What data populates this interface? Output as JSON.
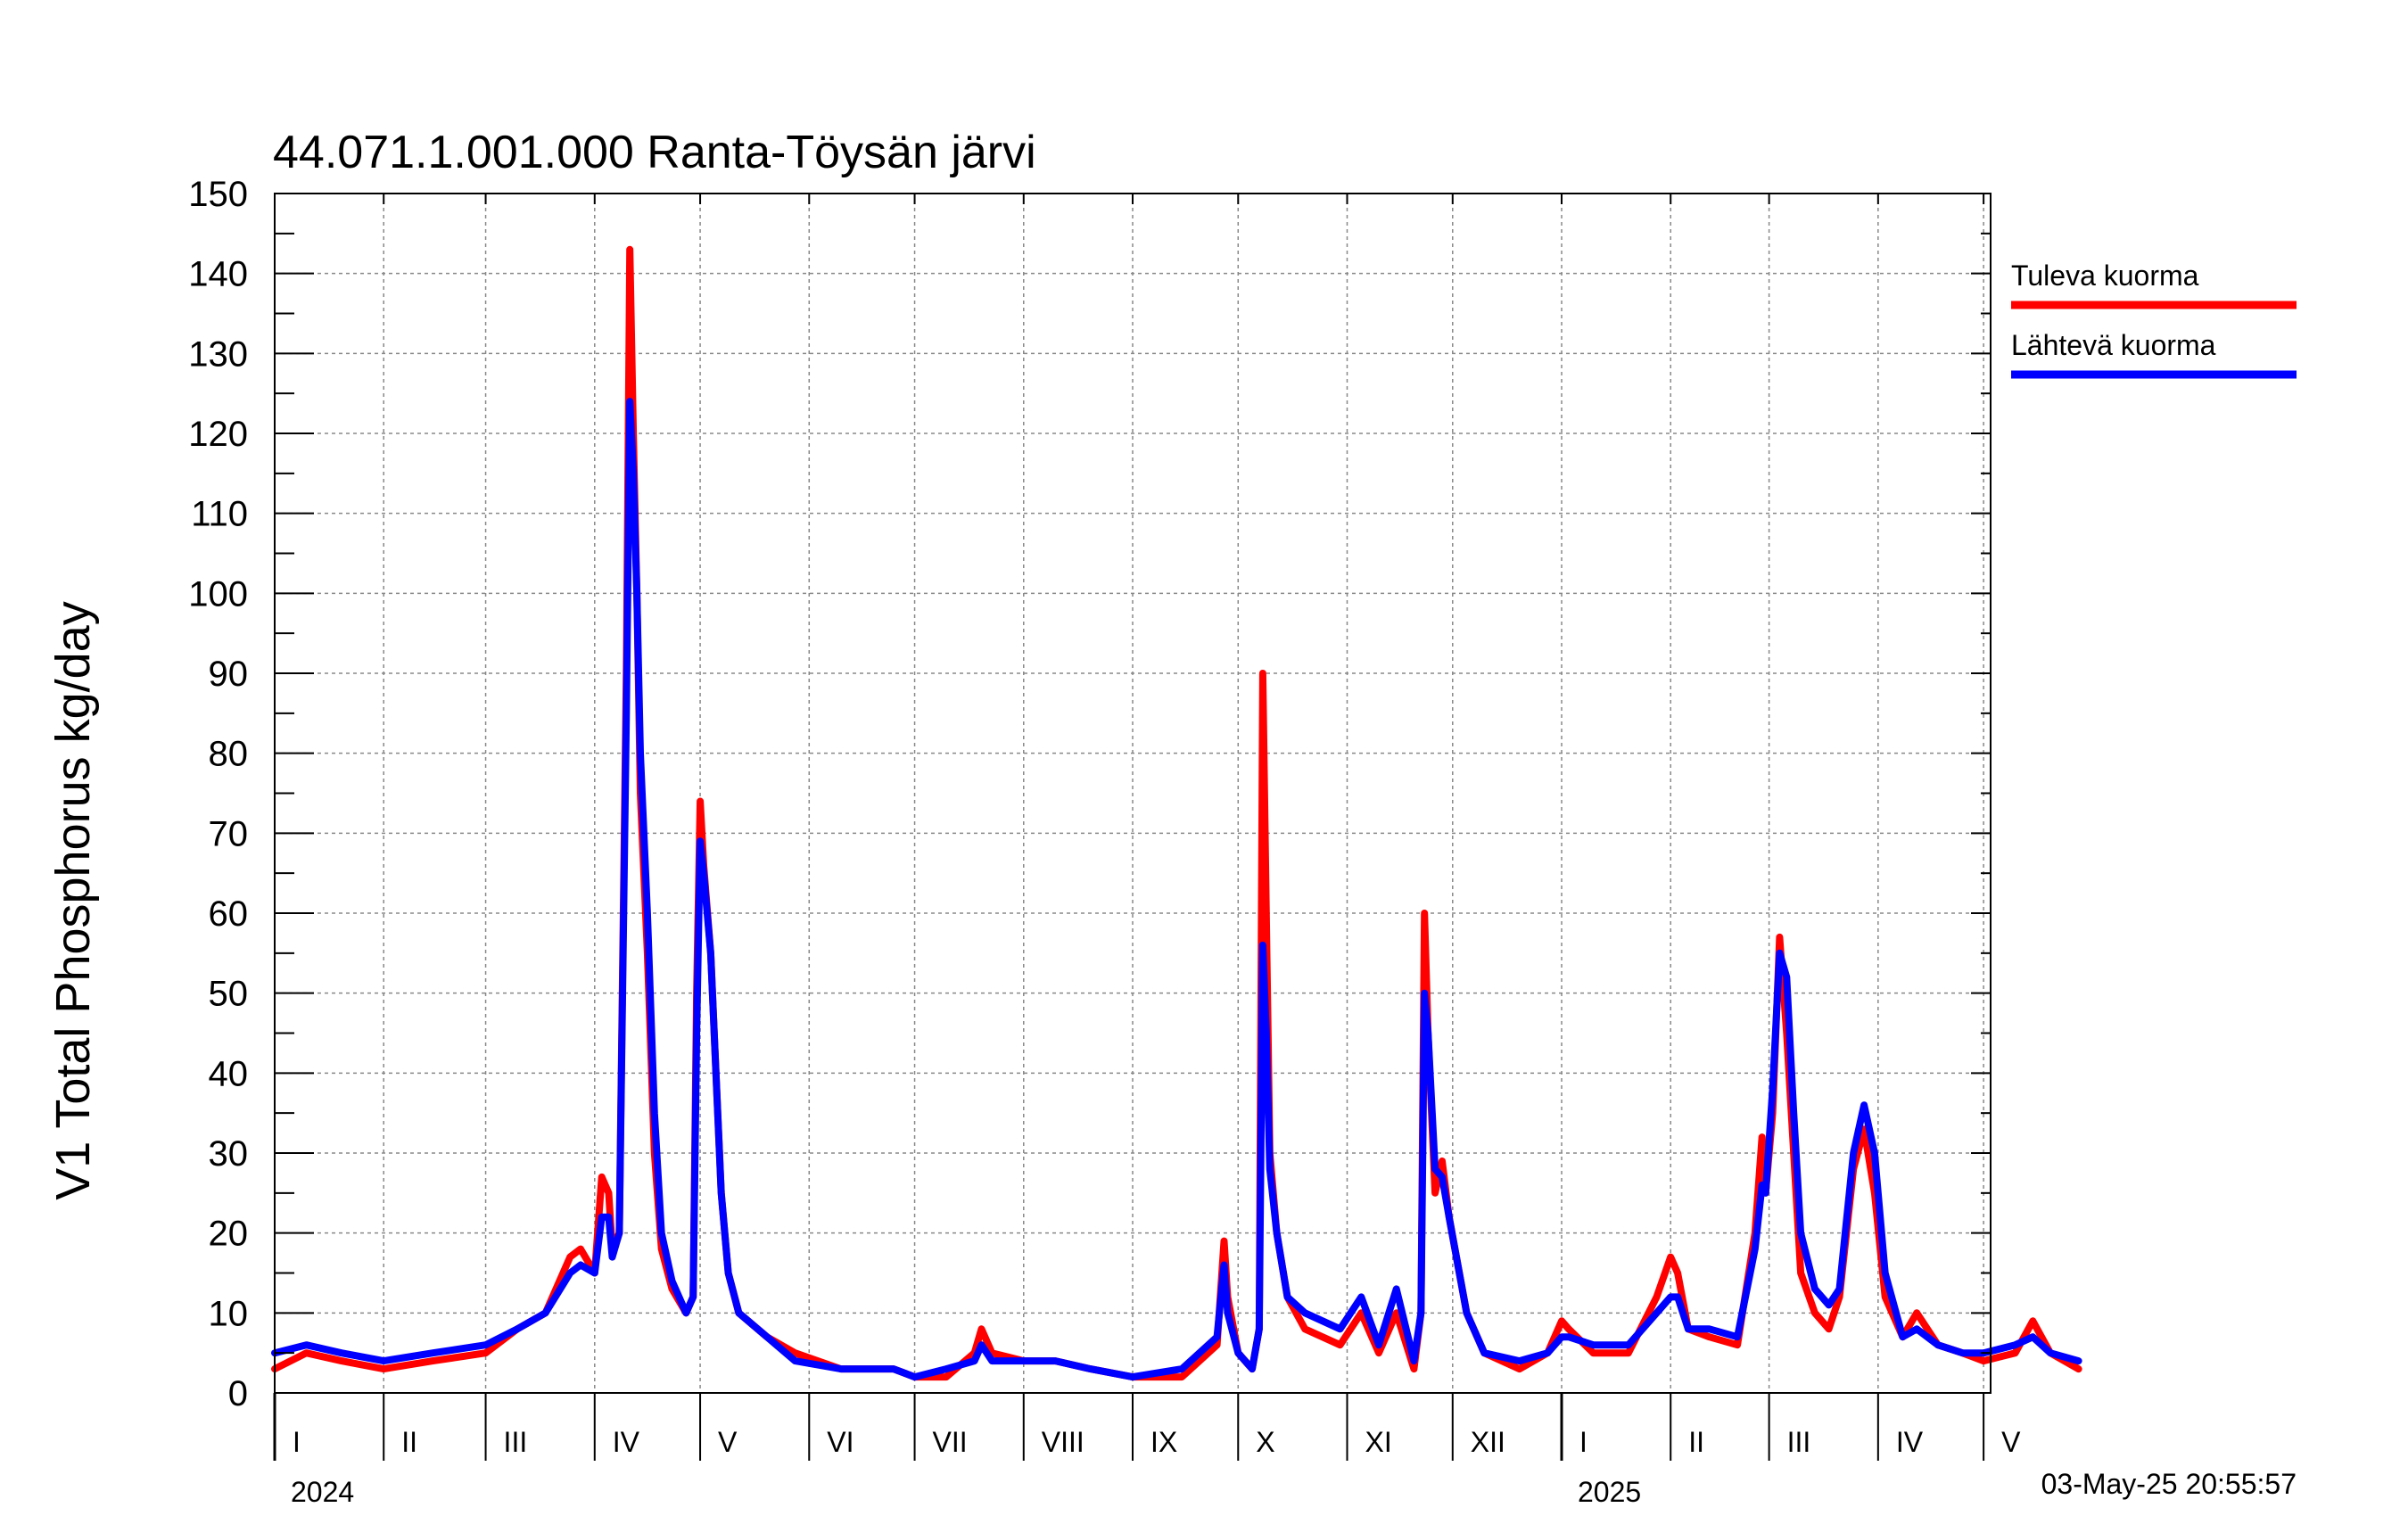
{
  "chart_data": {
    "type": "line",
    "title": "44.071.1.001.000 Ranta-Töysän järvi",
    "ylabel": "V1 Total Phosphorus kg/day",
    "ylim": [
      0,
      150
    ],
    "yticks": [
      0,
      10,
      20,
      30,
      40,
      50,
      60,
      70,
      80,
      90,
      100,
      110,
      120,
      130,
      140,
      150
    ],
    "xlim": [
      "2024-01-01",
      "2025-05-03"
    ],
    "months": [
      {
        "label": "I",
        "start": "2024-01-01"
      },
      {
        "label": "II",
        "start": "2024-02-01"
      },
      {
        "label": "III",
        "start": "2024-03-01"
      },
      {
        "label": "IV",
        "start": "2024-04-01"
      },
      {
        "label": "V",
        "start": "2024-05-01"
      },
      {
        "label": "VI",
        "start": "2024-06-01"
      },
      {
        "label": "VII",
        "start": "2024-07-01"
      },
      {
        "label": "VIII",
        "start": "2024-08-01"
      },
      {
        "label": "IX",
        "start": "2024-09-01"
      },
      {
        "label": "X",
        "start": "2024-10-01"
      },
      {
        "label": "XI",
        "start": "2024-11-01"
      },
      {
        "label": "XII",
        "start": "2024-12-01"
      },
      {
        "label": "I",
        "start": "2025-01-01"
      },
      {
        "label": "II",
        "start": "2025-02-01"
      },
      {
        "label": "III",
        "start": "2025-03-01"
      },
      {
        "label": "IV",
        "start": "2025-04-01"
      },
      {
        "label": "V",
        "start": "2025-05-01"
      }
    ],
    "years": [
      {
        "label": "2024",
        "start": "2024-01-01"
      },
      {
        "label": "2025",
        "start": "2025-01-01"
      }
    ],
    "grid": true,
    "legend_position": "right",
    "series": [
      {
        "name": "Tuleva kuorma",
        "color": "#ff0000",
        "points": [
          [
            "2024-01-01",
            3
          ],
          [
            "2024-01-10",
            5
          ],
          [
            "2024-01-20",
            4
          ],
          [
            "2024-02-01",
            3
          ],
          [
            "2024-02-15",
            4
          ],
          [
            "2024-03-01",
            5
          ],
          [
            "2024-03-10",
            8
          ],
          [
            "2024-03-18",
            10
          ],
          [
            "2024-03-25",
            17
          ],
          [
            "2024-03-28",
            18
          ],
          [
            "2024-04-01",
            15
          ],
          [
            "2024-04-03",
            27
          ],
          [
            "2024-04-05",
            25
          ],
          [
            "2024-04-06",
            18
          ],
          [
            "2024-04-08",
            20
          ],
          [
            "2024-04-10",
            90
          ],
          [
            "2024-04-11",
            143
          ],
          [
            "2024-04-12",
            120
          ],
          [
            "2024-04-13",
            100
          ],
          [
            "2024-04-14",
            75
          ],
          [
            "2024-04-16",
            55
          ],
          [
            "2024-04-18",
            30
          ],
          [
            "2024-04-20",
            18
          ],
          [
            "2024-04-23",
            13
          ],
          [
            "2024-04-27",
            10
          ],
          [
            "2024-04-29",
            12
          ],
          [
            "2024-04-30",
            50
          ],
          [
            "2024-05-01",
            74
          ],
          [
            "2024-05-02",
            66
          ],
          [
            "2024-05-04",
            55
          ],
          [
            "2024-05-05",
            45
          ],
          [
            "2024-05-07",
            25
          ],
          [
            "2024-05-09",
            15
          ],
          [
            "2024-05-12",
            10
          ],
          [
            "2024-05-20",
            7
          ],
          [
            "2024-05-28",
            5
          ],
          [
            "2024-06-10",
            3
          ],
          [
            "2024-06-25",
            3
          ],
          [
            "2024-07-01",
            2
          ],
          [
            "2024-07-10",
            2
          ],
          [
            "2024-07-18",
            5
          ],
          [
            "2024-07-20",
            8
          ],
          [
            "2024-07-23",
            5
          ],
          [
            "2024-08-01",
            4
          ],
          [
            "2024-08-10",
            4
          ],
          [
            "2024-08-20",
            3
          ],
          [
            "2024-09-01",
            2
          ],
          [
            "2024-09-15",
            2
          ],
          [
            "2024-09-25",
            6
          ],
          [
            "2024-09-27",
            19
          ],
          [
            "2024-09-28",
            12
          ],
          [
            "2024-10-01",
            5
          ],
          [
            "2024-10-05",
            3
          ],
          [
            "2024-10-07",
            8
          ],
          [
            "2024-10-08",
            90
          ],
          [
            "2024-10-09",
            60
          ],
          [
            "2024-10-10",
            30
          ],
          [
            "2024-10-12",
            20
          ],
          [
            "2024-10-15",
            12
          ],
          [
            "2024-10-20",
            8
          ],
          [
            "2024-10-30",
            6
          ],
          [
            "2024-11-05",
            10
          ],
          [
            "2024-11-10",
            5
          ],
          [
            "2024-11-15",
            10
          ],
          [
            "2024-11-20",
            3
          ],
          [
            "2024-11-22",
            10
          ],
          [
            "2024-11-23",
            60
          ],
          [
            "2024-11-24",
            45
          ],
          [
            "2024-11-26",
            25
          ],
          [
            "2024-11-28",
            29
          ],
          [
            "2024-11-30",
            22
          ],
          [
            "2024-12-05",
            10
          ],
          [
            "2024-12-10",
            5
          ],
          [
            "2024-12-20",
            3
          ],
          [
            "2024-12-28",
            5
          ],
          [
            "2025-01-01",
            9
          ],
          [
            "2025-01-03",
            8
          ],
          [
            "2025-01-10",
            5
          ],
          [
            "2025-01-20",
            5
          ],
          [
            "2025-01-28",
            12
          ],
          [
            "2025-02-01",
            17
          ],
          [
            "2025-02-03",
            15
          ],
          [
            "2025-02-06",
            8
          ],
          [
            "2025-02-12",
            7
          ],
          [
            "2025-02-20",
            6
          ],
          [
            "2025-02-25",
            20
          ],
          [
            "2025-02-27",
            32
          ],
          [
            "2025-02-28",
            25
          ],
          [
            "2025-03-02",
            35
          ],
          [
            "2025-03-04",
            57
          ],
          [
            "2025-03-06",
            45
          ],
          [
            "2025-03-08",
            30
          ],
          [
            "2025-03-10",
            15
          ],
          [
            "2025-03-14",
            10
          ],
          [
            "2025-03-18",
            8
          ],
          [
            "2025-03-21",
            12
          ],
          [
            "2025-03-25",
            28
          ],
          [
            "2025-03-28",
            33
          ],
          [
            "2025-03-31",
            25
          ],
          [
            "2025-04-03",
            12
          ],
          [
            "2025-04-08",
            7
          ],
          [
            "2025-04-12",
            10
          ],
          [
            "2025-04-18",
            6
          ],
          [
            "2025-04-25",
            5
          ],
          [
            "2025-05-01",
            4
          ],
          [
            "2025-05-10",
            5
          ],
          [
            "2025-05-15",
            9
          ],
          [
            "2025-05-20",
            5
          ],
          [
            "2025-05-28",
            3
          ]
        ]
      },
      {
        "name": "Lähtevä kuorma",
        "color": "#0000ff",
        "points": [
          [
            "2024-01-01",
            5
          ],
          [
            "2024-01-10",
            6
          ],
          [
            "2024-01-20",
            5
          ],
          [
            "2024-02-01",
            4
          ],
          [
            "2024-02-15",
            5
          ],
          [
            "2024-03-01",
            6
          ],
          [
            "2024-03-10",
            8
          ],
          [
            "2024-03-18",
            10
          ],
          [
            "2024-03-25",
            15
          ],
          [
            "2024-03-28",
            16
          ],
          [
            "2024-04-01",
            15
          ],
          [
            "2024-04-03",
            22
          ],
          [
            "2024-04-05",
            22
          ],
          [
            "2024-04-06",
            17
          ],
          [
            "2024-04-08",
            20
          ],
          [
            "2024-04-10",
            85
          ],
          [
            "2024-04-11",
            124
          ],
          [
            "2024-04-12",
            115
          ],
          [
            "2024-04-13",
            100
          ],
          [
            "2024-04-14",
            80
          ],
          [
            "2024-04-16",
            60
          ],
          [
            "2024-04-18",
            35
          ],
          [
            "2024-04-20",
            20
          ],
          [
            "2024-04-23",
            14
          ],
          [
            "2024-04-27",
            10
          ],
          [
            "2024-04-29",
            12
          ],
          [
            "2024-04-30",
            45
          ],
          [
            "2024-05-01",
            69
          ],
          [
            "2024-05-02",
            65
          ],
          [
            "2024-05-04",
            55
          ],
          [
            "2024-05-05",
            45
          ],
          [
            "2024-05-07",
            25
          ],
          [
            "2024-05-09",
            15
          ],
          [
            "2024-05-12",
            10
          ],
          [
            "2024-05-20",
            7
          ],
          [
            "2024-05-28",
            4
          ],
          [
            "2024-06-10",
            3
          ],
          [
            "2024-06-25",
            3
          ],
          [
            "2024-07-01",
            2
          ],
          [
            "2024-07-10",
            3
          ],
          [
            "2024-07-18",
            4
          ],
          [
            "2024-07-20",
            6
          ],
          [
            "2024-07-23",
            4
          ],
          [
            "2024-08-01",
            4
          ],
          [
            "2024-08-10",
            4
          ],
          [
            "2024-08-20",
            3
          ],
          [
            "2024-09-01",
            2
          ],
          [
            "2024-09-15",
            3
          ],
          [
            "2024-09-25",
            7
          ],
          [
            "2024-09-27",
            16
          ],
          [
            "2024-09-28",
            10
          ],
          [
            "2024-10-01",
            5
          ],
          [
            "2024-10-05",
            3
          ],
          [
            "2024-10-07",
            8
          ],
          [
            "2024-10-08",
            56
          ],
          [
            "2024-10-09",
            45
          ],
          [
            "2024-10-10",
            28
          ],
          [
            "2024-10-12",
            20
          ],
          [
            "2024-10-15",
            12
          ],
          [
            "2024-10-20",
            10
          ],
          [
            "2024-10-30",
            8
          ],
          [
            "2024-11-05",
            12
          ],
          [
            "2024-11-10",
            6
          ],
          [
            "2024-11-15",
            13
          ],
          [
            "2024-11-20",
            4
          ],
          [
            "2024-11-22",
            10
          ],
          [
            "2024-11-23",
            50
          ],
          [
            "2024-11-24",
            45
          ],
          [
            "2024-11-26",
            28
          ],
          [
            "2024-11-28",
            27
          ],
          [
            "2024-11-30",
            22
          ],
          [
            "2024-12-05",
            10
          ],
          [
            "2024-12-10",
            5
          ],
          [
            "2024-12-20",
            4
          ],
          [
            "2024-12-28",
            5
          ],
          [
            "2025-01-01",
            7
          ],
          [
            "2025-01-03",
            7
          ],
          [
            "2025-01-10",
            6
          ],
          [
            "2025-01-20",
            6
          ],
          [
            "2025-01-28",
            10
          ],
          [
            "2025-02-01",
            12
          ],
          [
            "2025-02-03",
            12
          ],
          [
            "2025-02-06",
            8
          ],
          [
            "2025-02-12",
            8
          ],
          [
            "2025-02-20",
            7
          ],
          [
            "2025-02-25",
            18
          ],
          [
            "2025-02-27",
            26
          ],
          [
            "2025-02-28",
            25
          ],
          [
            "2025-03-02",
            38
          ],
          [
            "2025-03-04",
            55
          ],
          [
            "2025-03-06",
            52
          ],
          [
            "2025-03-08",
            35
          ],
          [
            "2025-03-10",
            20
          ],
          [
            "2025-03-14",
            13
          ],
          [
            "2025-03-18",
            11
          ],
          [
            "2025-03-21",
            13
          ],
          [
            "2025-03-25",
            30
          ],
          [
            "2025-03-28",
            36
          ],
          [
            "2025-03-31",
            30
          ],
          [
            "2025-04-03",
            15
          ],
          [
            "2025-04-08",
            7
          ],
          [
            "2025-04-12",
            8
          ],
          [
            "2025-04-18",
            6
          ],
          [
            "2025-04-25",
            5
          ],
          [
            "2025-05-01",
            5
          ],
          [
            "2025-05-10",
            6
          ],
          [
            "2025-05-15",
            7
          ],
          [
            "2025-05-20",
            5
          ],
          [
            "2025-05-28",
            4
          ]
        ]
      }
    ]
  },
  "timestamp": "03-May-25 20:55:57"
}
